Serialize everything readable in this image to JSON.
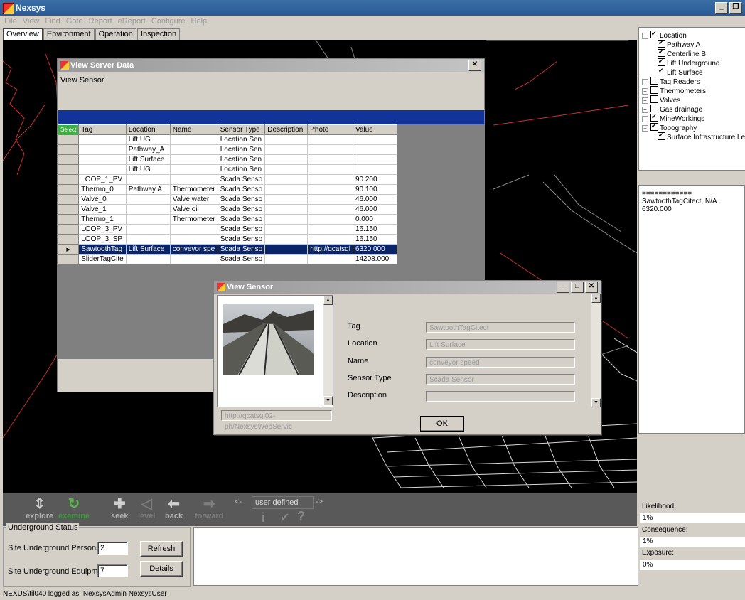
{
  "app": {
    "title": "Nexsys"
  },
  "menu": [
    "File",
    "View",
    "Find",
    "Goto",
    "Report",
    "eReport",
    "Configure",
    "Help"
  ],
  "tabs": [
    "Overview",
    "Environment",
    "Operation",
    "Inspection"
  ],
  "tree": [
    {
      "label": "Location",
      "checked": true,
      "expander": "−",
      "indent": 0
    },
    {
      "label": "Pathway A",
      "checked": true,
      "indent": 1
    },
    {
      "label": "Centerline B",
      "checked": true,
      "indent": 1
    },
    {
      "label": "Lift Underground",
      "checked": true,
      "indent": 1
    },
    {
      "label": "Lift Surface",
      "checked": true,
      "indent": 1
    },
    {
      "label": "Tag Readers",
      "checked": false,
      "expander": "+",
      "indent": 0
    },
    {
      "label": "Thermometers",
      "checked": false,
      "expander": "+",
      "indent": 0
    },
    {
      "label": "Valves",
      "checked": false,
      "expander": "+",
      "indent": 0
    },
    {
      "label": "Gas drainage",
      "checked": false,
      "expander": "+",
      "indent": 0
    },
    {
      "label": "MineWorkings",
      "checked": true,
      "expander": "+",
      "indent": 0
    },
    {
      "label": "Topography",
      "checked": true,
      "expander": "−",
      "indent": 0
    },
    {
      "label": "Surface Infrastructure Lea",
      "checked": true,
      "indent": 1
    }
  ],
  "side_info": {
    "line1": "============",
    "line2": "SawtoothTagCitect, N/A",
    "line3": "6320.000"
  },
  "risk": {
    "likelihood_label": "Likelihood:",
    "likelihood": "1%",
    "consequence_label": "Consequence:",
    "consequence": "1%",
    "exposure_label": "Exposure:",
    "exposure": "0%"
  },
  "server_window": {
    "title": "View Server Data",
    "subtitle": "View Sensor",
    "columns": [
      "Select",
      "Tag",
      "Location",
      "Name",
      "Sensor Type",
      "Description",
      "Photo",
      "Value"
    ],
    "rows": [
      [
        "",
        "Lift UG",
        "",
        "Location Sen",
        "",
        "",
        ""
      ],
      [
        "",
        "Pathway_A",
        "",
        "Location Sen",
        "",
        "",
        ""
      ],
      [
        "",
        "Lift Surface",
        "",
        "Location Sen",
        "",
        "",
        ""
      ],
      [
        "",
        "Lift UG",
        "",
        "Location Sen",
        "",
        "",
        ""
      ],
      [
        "LOOP_1_PV",
        "",
        "",
        "Scada Senso",
        "",
        "",
        "90.200"
      ],
      [
        "Thermo_0",
        "Pathway A",
        "Thermometer",
        "Scada Senso",
        "",
        "",
        "90.100"
      ],
      [
        "Valve_0",
        "",
        "Valve water",
        "Scada Senso",
        "",
        "",
        "46.000"
      ],
      [
        "Valve_1",
        "",
        "Valve oil",
        "Scada Senso",
        "",
        "",
        "46.000"
      ],
      [
        "Thermo_1",
        "",
        "Thermometer",
        "Scada Senso",
        "",
        "",
        "0.000"
      ],
      [
        "LOOP_3_PV",
        "",
        "",
        "Scada Senso",
        "",
        "",
        "16.150"
      ],
      [
        "LOOP_3_SP",
        "",
        "",
        "Scada Senso",
        "",
        "",
        "16.150"
      ],
      [
        "SawtoothTag",
        "Lift Surface",
        "conveyor spe",
        "Scada Senso",
        "",
        "http://qcatsql",
        "6320.000"
      ],
      [
        "SliderTagCite",
        "",
        "",
        "Scada Senso",
        "",
        "",
        "14208.000"
      ]
    ],
    "selected_row": 11
  },
  "sensor_window": {
    "title": "View Sensor",
    "url": "http://qcatsql02-ph/NexsysWebServic",
    "tag_label": "Tag",
    "tag": "SawtoothTagCitect",
    "location_label": "Location",
    "location": "Lift Surface",
    "name_label": "Name",
    "name": "conveyor speed",
    "type_label": "Sensor Type",
    "type": "Scada Sensor",
    "desc_label": "Description",
    "desc": "",
    "ok": "OK"
  },
  "toolbar": {
    "explore": "explore",
    "examine": "examine",
    "seek": "seek",
    "level": "level",
    "back": "back",
    "forward": "forward",
    "mode": "user defined",
    "prev": "<-",
    "next": "->"
  },
  "status_panel": {
    "legend": "Underground Status",
    "persons_label": "Site Underground Persons:",
    "persons": "2",
    "equipment_label": "Site Underground Equipment:",
    "equipment": "7",
    "refresh": "Refresh",
    "details": "Details"
  },
  "statusbar": "NEXUS\\til040 logged as :NexsysAdmin NexsysUser"
}
